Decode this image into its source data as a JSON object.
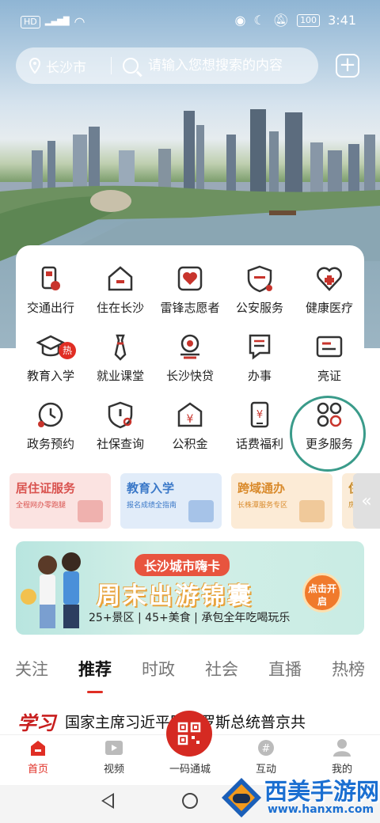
{
  "status": {
    "left_badges": [
      "HD",
      "5G"
    ],
    "time": "3:41",
    "battery": "100"
  },
  "search": {
    "city": "长沙市",
    "placeholder": "请输入您想搜索的内容"
  },
  "services": [
    {
      "label": "交通出行",
      "icon": "transit-card-icon"
    },
    {
      "label": "住在长沙",
      "icon": "house-icon"
    },
    {
      "label": "雷锋志愿者",
      "icon": "volunteer-heart-icon"
    },
    {
      "label": "公安服务",
      "icon": "police-shield-icon"
    },
    {
      "label": "健康医疗",
      "icon": "health-heart-icon"
    },
    {
      "label": "教育入学",
      "icon": "graduation-cap-icon",
      "badge": "热"
    },
    {
      "label": "就业课堂",
      "icon": "necktie-icon"
    },
    {
      "label": "长沙快贷",
      "icon": "loan-coin-icon"
    },
    {
      "label": "办事",
      "icon": "document-icon"
    },
    {
      "label": "亮证",
      "icon": "id-card-icon"
    },
    {
      "label": "政务预约",
      "icon": "clock-icon"
    },
    {
      "label": "社保查询",
      "icon": "social-security-search-icon"
    },
    {
      "label": "公积金",
      "icon": "fund-envelope-icon"
    },
    {
      "label": "话费福利",
      "icon": "phone-bill-icon"
    },
    {
      "label": "更多服务",
      "icon": "more-grid-icon"
    }
  ],
  "minicards": [
    {
      "title": "居住证服务",
      "sub": "全程网办零跑腿",
      "color": "#d9534f",
      "bg": "#fbe3e1"
    },
    {
      "title": "教育入学",
      "sub": "报名成绩全指南",
      "color": "#3a78c8",
      "bg": "#e1ecf9"
    },
    {
      "title": "跨域通办",
      "sub": "长株潭服务专区",
      "color": "#d98a2b",
      "bg": "#fcebd6"
    },
    {
      "title": "住",
      "sub": "房",
      "color": "#c58a2b",
      "bg": "#fbecd8"
    }
  ],
  "collapse_label": "«",
  "banner": {
    "tag": "长沙城市嗨卡",
    "headline": "周末出游锦囊",
    "sub": "25+景区 | 45+美食 | 承包全年吃喝玩乐",
    "button": "点击开启"
  },
  "tabs": [
    "关注",
    "推荐",
    "时政",
    "社会",
    "直播",
    "热榜"
  ],
  "active_tab": "推荐",
  "news": {
    "source": "学习",
    "title": "国家主席习近平同俄罗斯总统普京共"
  },
  "bottom_nav": [
    {
      "label": "首页",
      "icon": "home-icon",
      "active": true
    },
    {
      "label": "视频",
      "icon": "video-icon",
      "active": false
    },
    {
      "label": "一码通城",
      "icon": "qr-code-icon",
      "active": false
    },
    {
      "label": "互动",
      "icon": "chat-hash-icon",
      "active": false
    },
    {
      "label": "我的",
      "icon": "profile-icon",
      "active": false
    }
  ],
  "watermark": {
    "title": "西美手游网",
    "url": "www.hanxm.com"
  },
  "colors": {
    "accent": "#e02e24",
    "highlight_circle": "#3a9b8a"
  }
}
